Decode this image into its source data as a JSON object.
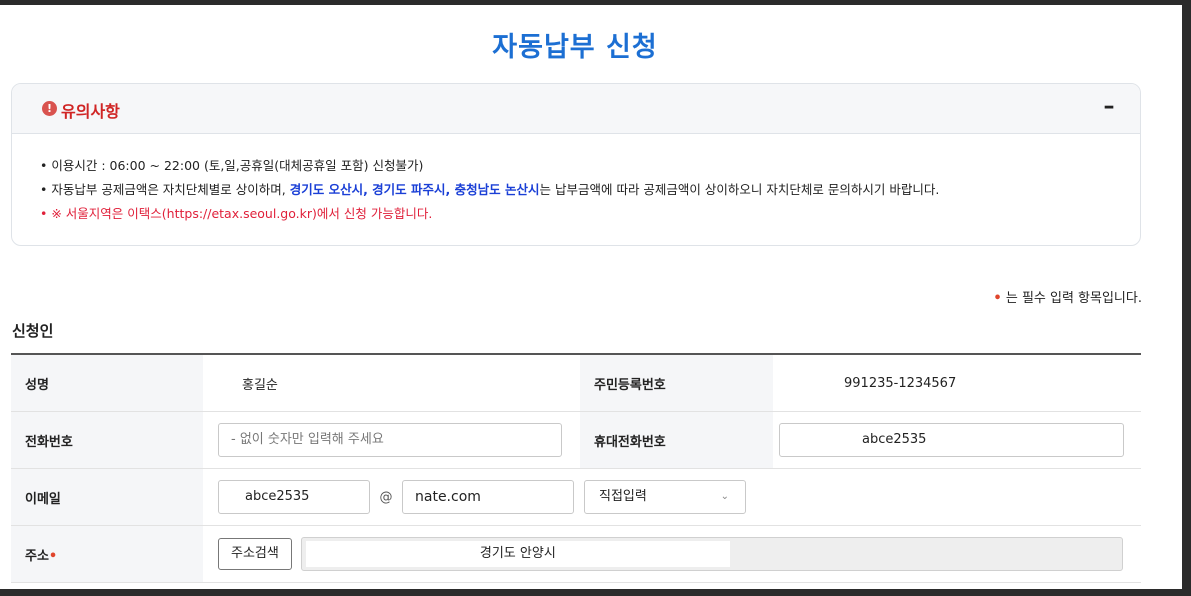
{
  "page": {
    "title": "자동납부 신청"
  },
  "notice": {
    "icon": "!",
    "title": "유의사항",
    "collapse": "–",
    "line1": "이용시간 : 06:00 ~ 22:00 (토,일,공휴일(대체공휴일 포함) 신청불가)",
    "line2_pre": "자동납부 공제금액은 자치단체별로 상이하며, ",
    "line2_highlight": "경기도 오산시, 경기도 파주시, 충청남도 논산시",
    "line2_post": "는 납부금액에 따라 공제금액이 상이하오니 자치단체로 문의하시기 바랍니다.",
    "line3": "※ 서울지역은 이택스(https://etax.seoul.go.kr)에서 신청 가능합니다."
  },
  "required_note": {
    "dot": "•",
    "text": "는 필수 입력 항목입니다."
  },
  "section": {
    "title": "신청인"
  },
  "form": {
    "name_label": "성명",
    "name_value": "홍길순",
    "rrn_label": "주민등록번호",
    "rrn_value": "991235-1234567",
    "phone_label": "전화번호",
    "phone_placeholder": "- 없이 숫자만 입력해 주세요",
    "mobile_label": "휴대전화번호",
    "mobile_value": "abce2535",
    "email_label": "이메일",
    "email_id": "abce2535",
    "email_at": "@",
    "email_domain": "nate.com",
    "email_select": "직접입력",
    "address_label": "주소",
    "address_required": "•",
    "address_search_btn": "주소검색",
    "address_value": "경기도 안양시"
  },
  "colors": {
    "title": "#1c6fd3",
    "notice_title": "#d02525",
    "highlight": "#1a3fd6",
    "warning": "#e0203a"
  }
}
